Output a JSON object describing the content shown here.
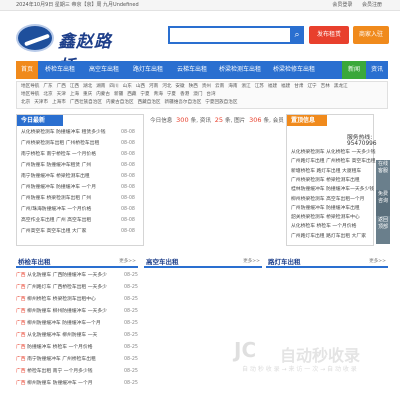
{
  "topbar": {
    "date": "2024年10月9日 星期三 帝京【京】周 九月Undefined",
    "links": [
      "会员登录",
      "会员注册"
    ]
  },
  "logo": {
    "text": "鑫赵路桥"
  },
  "search": {
    "placeholder": "",
    "button_icon": "search-icon"
  },
  "header_buttons": {
    "publish": "发布租赁",
    "join": "商家入驻"
  },
  "nav": {
    "items": [
      {
        "label": "首页",
        "type": "home"
      },
      {
        "label": "桥检车出租"
      },
      {
        "label": "高空车出租"
      },
      {
        "label": "路灯车出租"
      },
      {
        "label": "云梯车出租"
      },
      {
        "label": "桥梁检测车出租"
      },
      {
        "label": "桥梁检修车出租"
      },
      {
        "label": "新闻",
        "type": "news"
      },
      {
        "label": "资讯"
      }
    ]
  },
  "cities": {
    "row1": [
      "地区导航",
      "广东",
      "广西",
      "江西",
      "湖北",
      "湖南",
      "四川",
      "山东",
      "山西",
      "河南",
      "河北",
      "安徽",
      "陕西",
      "贵州",
      "云南",
      "海南",
      "浙江",
      "江苏",
      "福建",
      "福建",
      "甘肃",
      "辽宁",
      "吉林",
      "黑龙江"
    ],
    "row2": [
      "地区导航",
      "北京",
      "天津",
      "上海",
      "重庆",
      "内蒙古",
      "新疆",
      "西藏",
      "宁夏",
      "青海",
      "宁夏",
      "香港",
      "澳门",
      "台湾"
    ],
    "row3": [
      "北京",
      "天津市",
      "上海市",
      "广西壮族自治区",
      "内蒙古自治区",
      "西藏自治区",
      "新疆维吾尔自治区",
      "宁夏回族自治区"
    ]
  },
  "today_news": {
    "title": "今日最新",
    "items": [
      {
        "text": "从化桥梁检测车 防撞缓冲车 租赁多少钱",
        "date": "08-08"
      },
      {
        "text": "广州桥梁检测车出租 广州桥检车出租",
        "date": "08-08"
      },
      {
        "text": "南宁桥检车 南宁桥检车 一个月价格",
        "date": "08-08"
      },
      {
        "text": "广州防撞车 防撞缓冲车租赁 广州",
        "date": "08-08"
      },
      {
        "text": "南宁防撞缓冲车 桥梁检测车出租",
        "date": "08-08"
      },
      {
        "text": "广州防撞缓冲车 防撞缓冲车 一个月",
        "date": "08-08"
      },
      {
        "text": "广州防撞车 桥梁检测车出租 广州",
        "date": "08-08"
      },
      {
        "text": "广州/珠海防撞缓冲车 一个月价格",
        "date": "08-08"
      },
      {
        "text": "高空作业车出租 广州 高空车出租",
        "date": "08-08"
      },
      {
        "text": "广州高空车 高空车出租 大厂家",
        "date": "08-08"
      }
    ]
  },
  "stats": {
    "prefix": "今日信息",
    "n1": "300",
    "l1": "条, 资讯",
    "n2": "25",
    "l2": "条, 图片",
    "n3": "306",
    "l3": "条, 会员",
    "n4": "15",
    "l4": "位"
  },
  "recommend": {
    "title": "置顶信息",
    "phone_label": "服务热线:",
    "phone": "95470996",
    "items": [
      "从化桥梁检测车 从化桥检车 一天多少钱",
      "广州路灯车出租 广州桥检车 高空车出租",
      "新塘桥检车 路灯车出租 大厦租车",
      "广州桥梁检测车 桥梁检测车出租",
      "桂林防撞缓冲车 防撞缓冲车一天多少钱",
      "柳州桥梁检测车 高空车出租一个月",
      "广州防撞缓冲车 防撞缓冲车出租",
      "韶关桥梁检测车 桥梁检测车中心",
      "从化桥检车 桥检车 一个月价格",
      "广州路灯车出租 路灯车出租 大厂家"
    ]
  },
  "float_buttons": [
    "在线客服",
    "免费咨询",
    "返回顶部"
  ],
  "sections": [
    {
      "title": "桥检车出租",
      "more": "更多>>"
    },
    {
      "title": "高空车出租",
      "more": "更多>>"
    },
    {
      "title": "路灯车出租",
      "more": "更多>>"
    }
  ],
  "bridge_list": [
    {
      "tag": "广西",
      "text": "从化防撞车 广西防撞缓冲车 一天多少",
      "date": "08-25"
    },
    {
      "tag": "广西",
      "text": "广州路灯车 广西桥检车出租 一天多少",
      "date": "08-25"
    },
    {
      "tag": "广西",
      "text": "柳州桥检车 桥梁检测车出租中心",
      "date": "08-25"
    },
    {
      "tag": "广西",
      "text": "柳州防撞车 柳州防撞缓冲车 一天多少",
      "date": "08-25"
    },
    {
      "tag": "广西",
      "text": "柳州防撞缓冲车 防撞缓冲车一个月",
      "date": "08-25"
    },
    {
      "tag": "广西",
      "text": "从化防撞缓冲车 柳州防撞车 一天",
      "date": "08-25"
    },
    {
      "tag": "广西",
      "text": "防撞缓冲车 桥检车 一个月价格",
      "date": "08-25"
    },
    {
      "tag": "广西",
      "text": "南宁防撞缓冲车 广州桥检车出租",
      "date": "08-25"
    },
    {
      "tag": "广西",
      "text": "桥检车出租 南宁 一个月多少钱",
      "date": "08-25"
    },
    {
      "tag": "广西",
      "text": "柳州防撞车 防撞缓冲车 一个月",
      "date": "08-25"
    }
  ],
  "watermark": {
    "logo": "JC",
    "title": "自动秒收录",
    "slogan": "自 动 秒 收 录 → 来 访 一 次 → 自 动 收 录"
  }
}
